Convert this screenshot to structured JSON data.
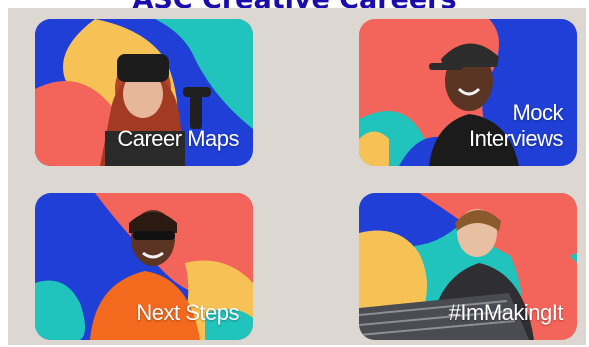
{
  "header": {
    "link_text": "ASC Creative Careers"
  },
  "colors": {
    "background_panel": "#dcd7d1",
    "blue": "#1f3fd6",
    "coral": "#f3645a",
    "teal": "#21c4bc",
    "yellow": "#f7c255",
    "link": "#1a0dab"
  },
  "cards": [
    {
      "label": "Career Maps",
      "photo": "person-vr-headset-photo"
    },
    {
      "label": "Mock\nInterviews",
      "photo": "person-smiling-cap-photo"
    },
    {
      "label": "Next Steps",
      "photo": "person-sunglasses-photo"
    },
    {
      "label": "#ImMakingIt",
      "photo": "person-mixing-desk-photo"
    }
  ]
}
